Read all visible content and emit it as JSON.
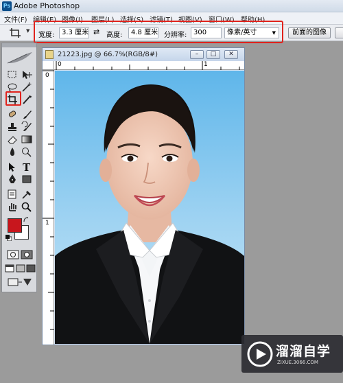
{
  "app": {
    "title": "Adobe Photoshop",
    "icon_label": "Ps"
  },
  "menu": [
    {
      "label": "文件(F)"
    },
    {
      "label": "编辑(E)"
    },
    {
      "label": "图像(I)"
    },
    {
      "label": "图层(L)"
    },
    {
      "label": "选择(S)"
    },
    {
      "label": "滤镜(T)"
    },
    {
      "label": "视图(V)"
    },
    {
      "label": "窗口(W)"
    },
    {
      "label": "帮助(H)"
    }
  ],
  "options": {
    "width_label": "宽度:",
    "width_value": "3.3 厘米",
    "height_label": "高度:",
    "height_value": "4.8 厘米",
    "resolution_label": "分辨率:",
    "resolution_value": "300",
    "unit_value": "像素/英寸",
    "front_image_label": "前面的图像"
  },
  "document": {
    "title": "21223.jpg @ 66.7%(RGB/8#)"
  },
  "rulers": {
    "h0": "0",
    "h1": "1",
    "v0": "0",
    "v1": "1"
  },
  "colors": {
    "foreground": "#c8161d",
    "background": "#ffffff",
    "highlight": "#e0231d"
  },
  "watermark": {
    "name": "溜溜自学",
    "url": "ZIXUE.3066.COM"
  }
}
